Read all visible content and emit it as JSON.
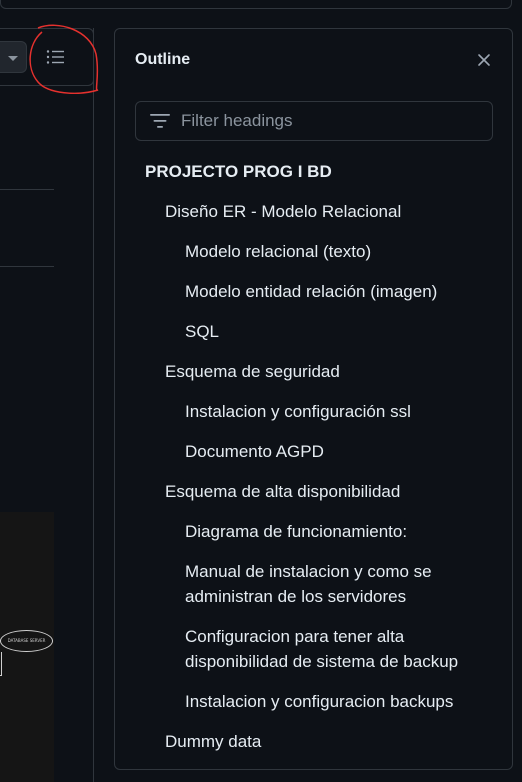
{
  "outline": {
    "title": "Outline",
    "filter_placeholder": "Filter headings",
    "headings": [
      {
        "level": 1,
        "text": "PROJECTO PROG I BD"
      },
      {
        "level": 2,
        "text": "Diseño ER - Modelo Relacional"
      },
      {
        "level": 3,
        "text": "Modelo relacional (texto)"
      },
      {
        "level": 3,
        "text": "Modelo entidad relación (imagen)"
      },
      {
        "level": 3,
        "text": "SQL"
      },
      {
        "level": 2,
        "text": "Esquema de seguridad"
      },
      {
        "level": 3,
        "text": "Instalacion y configuración ssl"
      },
      {
        "level": 3,
        "text": "Documento AGPD"
      },
      {
        "level": 2,
        "text": "Esquema de alta disponibilidad"
      },
      {
        "level": 3,
        "text": "Diagrama de funcionamiento:"
      },
      {
        "level": 3,
        "text": "Manual de instalacion y como se administran de los servidores"
      },
      {
        "level": 3,
        "text": "Configuracion para tener alta disponibilidad de sistema de backup"
      },
      {
        "level": 3,
        "text": "Instalacion y configuracion backups"
      },
      {
        "level": 2,
        "text": "Dummy data"
      }
    ]
  },
  "diagram": {
    "oval_label": "DATABASE SERVER"
  },
  "colors": {
    "background": "#0d1117",
    "border": "#30363d",
    "text": "#e6edf3",
    "muted": "#8b949e",
    "annotation": "#e5312e"
  },
  "icons": [
    "chevron-down-icon",
    "list-icon",
    "close-icon",
    "filter-icon"
  ]
}
